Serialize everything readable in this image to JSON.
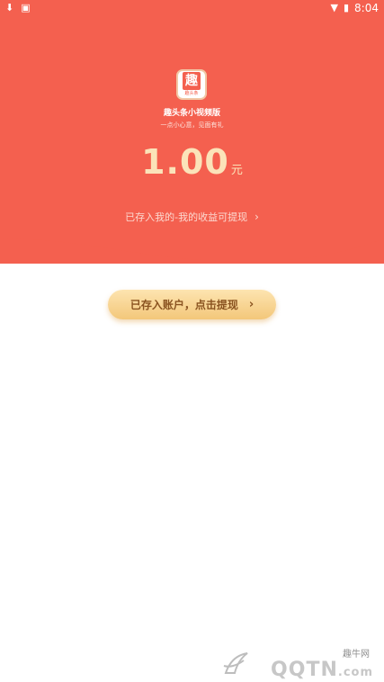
{
  "status_bar": {
    "time": "8:04",
    "left_icons": [
      "download-icon",
      "image-icon"
    ],
    "right_icons": [
      "wifi-icon",
      "battery-icon"
    ]
  },
  "app": {
    "logo_char": "趣",
    "logo_sub": "趣头条",
    "name": "趣头条小视频版",
    "slogan": "一点小心意，见面有礼"
  },
  "reward": {
    "amount": "1.00",
    "unit": "元"
  },
  "earnings_link": {
    "label": "已存入我的-我的收益可提现",
    "chevron": "›"
  },
  "withdraw_button": {
    "label": "已存入账户，点击提现",
    "chevron": "›"
  },
  "watermark": {
    "site": "趣牛网",
    "text": "QQTN",
    "domain": ".com"
  },
  "colors": {
    "header_red": "#f4604f",
    "amount_gold": "#fbe3b9",
    "button_gold": "#f3c77a",
    "button_text": "#8a5320"
  }
}
